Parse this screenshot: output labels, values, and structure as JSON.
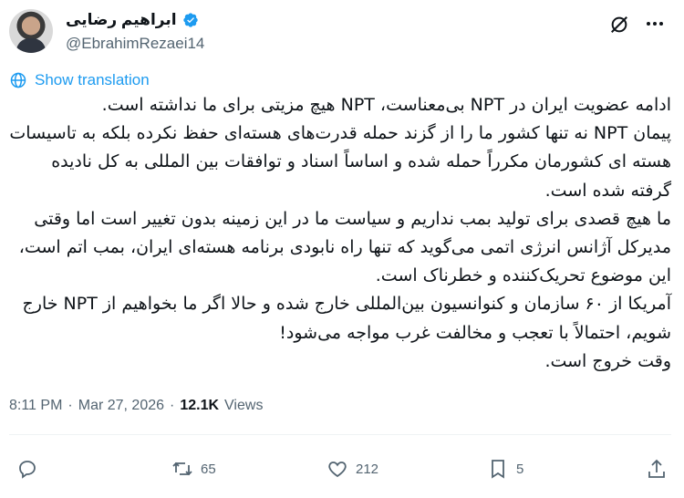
{
  "user": {
    "display_name": "ابراهیم رضایی",
    "handle": "@EbrahimRezaei14"
  },
  "translation_link": "Show translation",
  "post_text": "ادامه عضویت ایران در NPT بی‌معناست، NPT هیچ مزیتی برای ما نداشته است.\nپیمان NPT نه تنها کشور ما را از گزند حمله قدرت‌های هسته‌ای حفظ نکرده بلکه به تاسیسات هسته ای کشورمان مکرراً حمله شده و اساساً اسناد و توافقات بین المللی به کل نادیده گرفته شده است.\nما هیچ قصدی برای تولید بمب نداریم و سیاست ما در این زمینه بدون تغییر است اما وقتی مدیرکل آژانس انرژی اتمی می‌گوید که تنها راه نابودی برنامه هسته‌ای ایران، بمب اتم است، این موضوع تحریک‌کننده و خطرناک است.\nآمریکا از ۶۰ سازمان و کنوانسیون بین‌المللی خارج شده و حالا اگر ما بخواهیم از NPT خارج شویم، احتمالاً با تعجب و مخالفت غرب مواجه می‌شود!\nوقت خروج است.",
  "meta": {
    "time": "8:11 PM",
    "separator": "·",
    "date": "Mar 27, 2026",
    "views_count": "12.1K",
    "views_label": "Views"
  },
  "actions": {
    "reply": "",
    "reposts": "65",
    "likes": "212",
    "bookmarks": "5"
  },
  "colors": {
    "accent": "#1d9bf0",
    "secondary_text": "#536471"
  }
}
